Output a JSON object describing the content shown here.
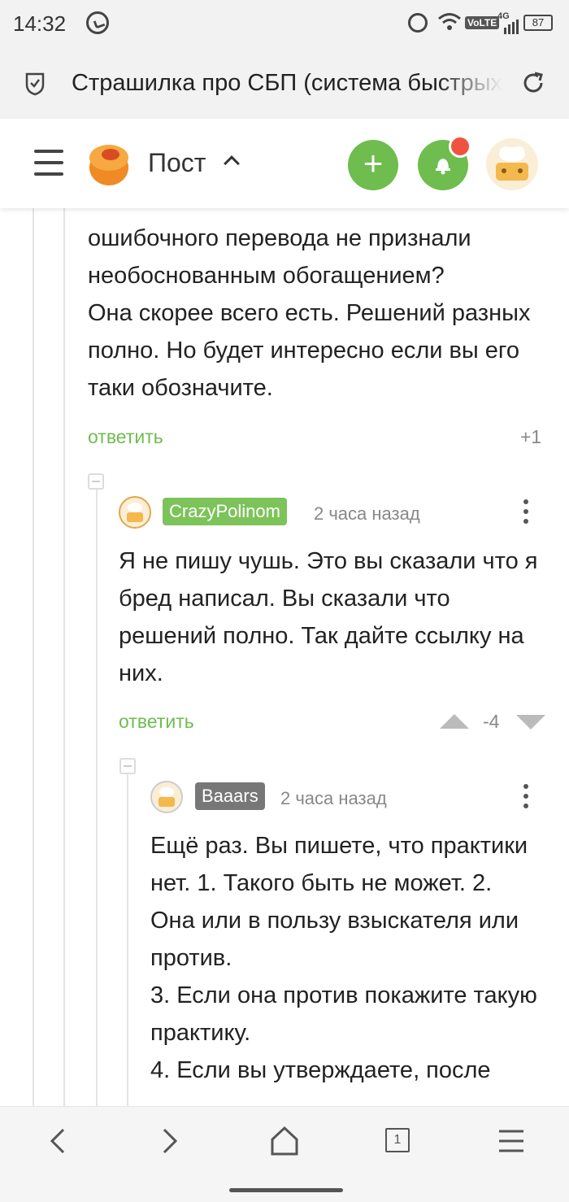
{
  "status_bar": {
    "time": "14:32",
    "network": "VoLTE",
    "signal": "4G",
    "battery": "87"
  },
  "url_bar": {
    "title": "Страшилка про СБП (система быстрых платежей)"
  },
  "header": {
    "title": "Пост"
  },
  "comment_0": {
    "text": "ошибочного перевода не признали необоснованным обогащением?\nОна скорее всего есть. Решений разных полно. Но будет интересно если вы его таки обозначите.",
    "reply_label": "ответить",
    "score": "+1"
  },
  "comment_1": {
    "author": "CrazyPolinom",
    "time": "2 часа назад",
    "text": "Я не пишу чушь. Это вы сказали что я бред написал. Вы сказали что решений полно. Так дайте ссылку на них.",
    "reply_label": "ответить",
    "score": "-4"
  },
  "comment_2": {
    "author": "Baaars",
    "time": "2 часа назад",
    "text": "Ещё раз. Вы пишете, что практики нет. 1. Такого быть не может. 2. Она или в пользу взыскателя или против.\n3. Если она против покажите такую практику.\n4. Если вы утверждаете, после"
  },
  "bottom_nav": {
    "tab_count": "1"
  },
  "colors": {
    "accent": "#6ebd4e",
    "notification": "#ef5241",
    "author_gray": "#777777"
  }
}
